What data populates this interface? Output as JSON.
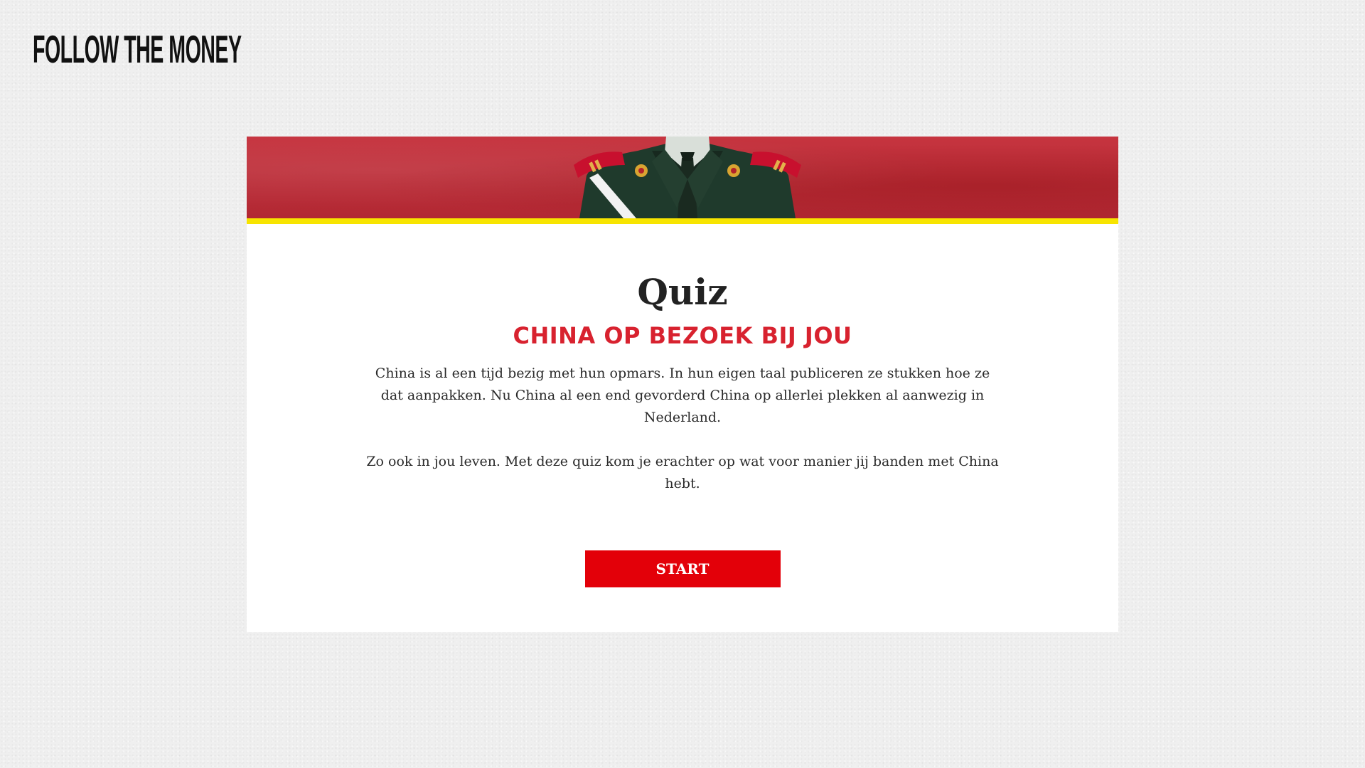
{
  "header": {
    "logo_text": "FOLLOW THE MONEY"
  },
  "quiz": {
    "title": "Quiz",
    "subtitle": "CHINA OP BEZOEK BIJ JOU",
    "intro_paragraph_1": "China is al een tijd bezig met hun opmars. In hun eigen taal publiceren ze stukken hoe ze dat aanpakken. Nu China al een end gevorderd China op allerlei plekken al aanwezig in Nederland.",
    "intro_paragraph_2": "Zo ook in jou leven. Met deze quiz kom je erachter op wat voor manier jij banden met China hebt.",
    "start_label": "START"
  },
  "banner": {
    "image": "soldier-in-uniform-on-red-background",
    "stripe_color": "#f7e400",
    "background_color": "#c6343f"
  },
  "colors": {
    "accent_red": "#d8222f",
    "button_red": "#e30009",
    "page_background": "#efefef",
    "card_background": "#ffffff"
  }
}
